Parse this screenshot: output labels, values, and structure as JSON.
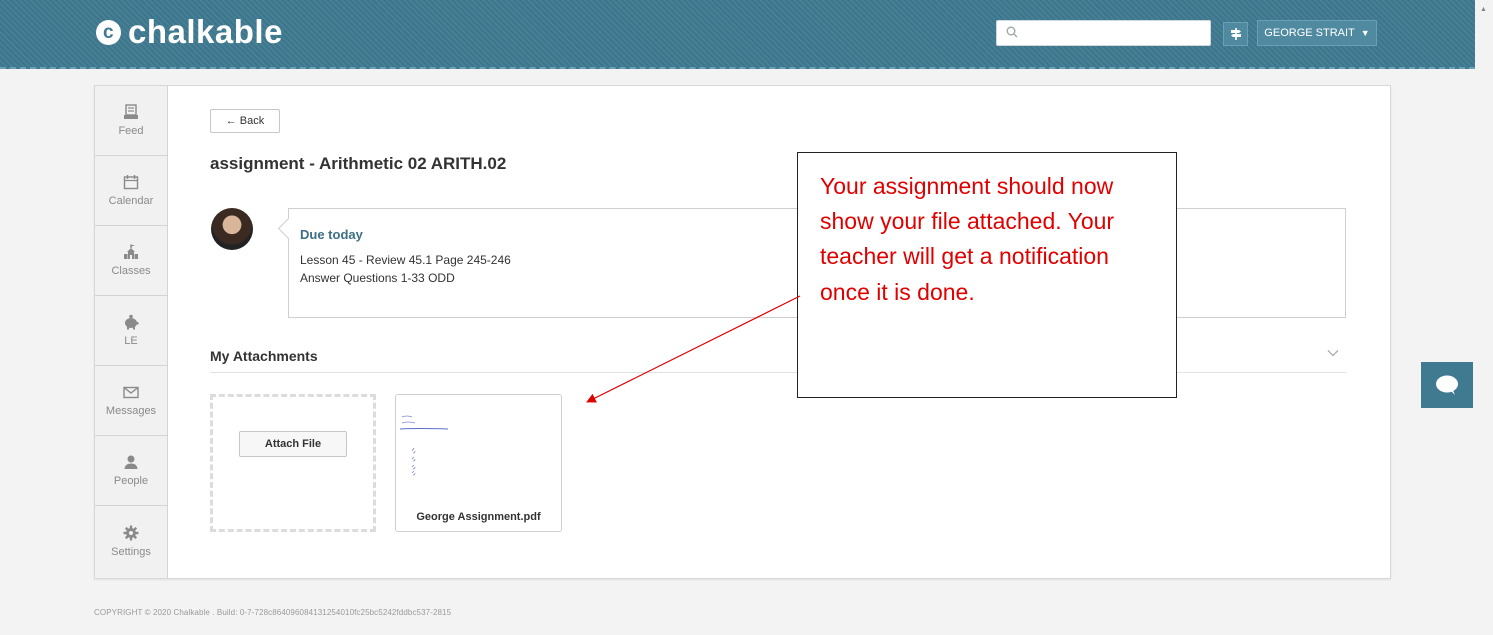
{
  "header": {
    "logo_text": "chalkable",
    "logo_mark": "c",
    "search": {
      "value": "",
      "placeholder": ""
    },
    "user_name": "GEORGE STRAIT",
    "colors": {
      "bar": "#3f7a91",
      "accent": "#4f8aa1"
    }
  },
  "sidebar": {
    "items": [
      {
        "label": "Feed",
        "icon": "feed-icon"
      },
      {
        "label": "Calendar",
        "icon": "calendar-icon"
      },
      {
        "label": "Classes",
        "icon": "classes-icon"
      },
      {
        "label": "LE",
        "icon": "piggy-bank-icon"
      },
      {
        "label": "Messages",
        "icon": "envelope-icon"
      },
      {
        "label": "People",
        "icon": "person-icon"
      },
      {
        "label": "Settings",
        "icon": "gear-icon"
      }
    ]
  },
  "main": {
    "back_label": "← Back",
    "title": "assignment - Arithmetic 02 ARITH.02",
    "due_label": "Due today",
    "description": [
      "Lesson 45 - Review 45.1 Page 245-246",
      "Answer Questions 1-33 ODD"
    ],
    "attachments": {
      "heading": "My Attachments",
      "attach_button": "Attach File",
      "files": [
        {
          "name": "George Assignment.pdf"
        }
      ]
    }
  },
  "callout": {
    "text": "Your assignment should now show your file attached. Your teacher will get a notification once it is done.",
    "color": "#e00000"
  },
  "footer": {
    "text": "COPYRIGHT © 2020 Chalkable . Build: 0-7-728c864096084131254010fc25bc5242fddbc537-2815"
  }
}
